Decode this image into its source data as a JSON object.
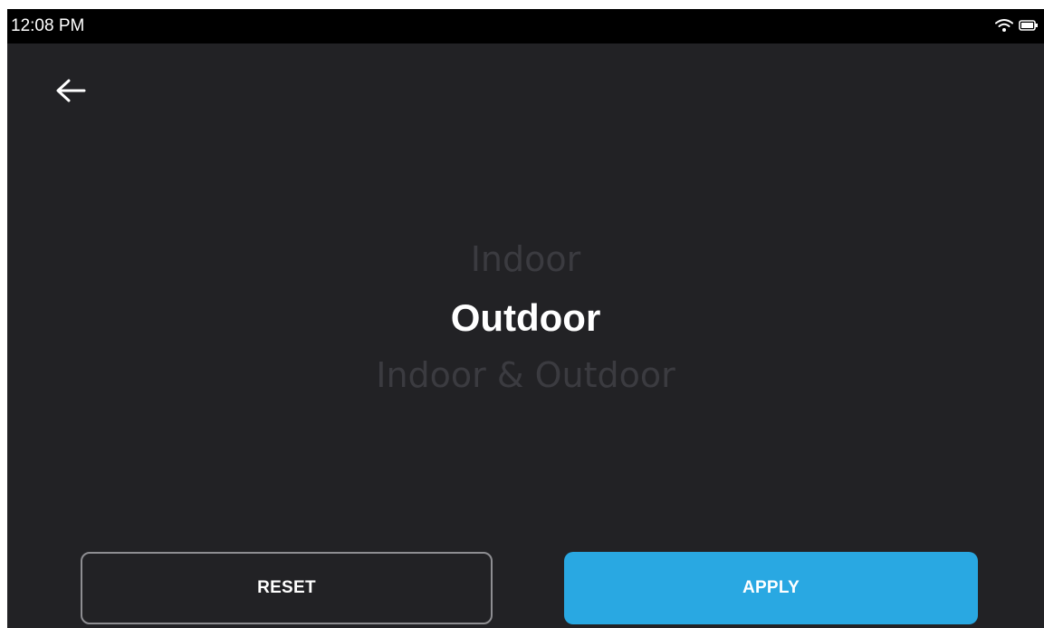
{
  "status_bar": {
    "time": "12:08 PM",
    "icons": [
      "wifi-icon",
      "battery-icon"
    ]
  },
  "nav": {
    "back_icon": "arrow-left-icon"
  },
  "picker": {
    "options": [
      "Indoor",
      "Outdoor",
      "Indoor & Outdoor"
    ],
    "selected": "Outdoor"
  },
  "actions": {
    "reset_label": "RESET",
    "apply_label": "APPLY"
  },
  "colors": {
    "background": "#222225",
    "status_bar": "#000000",
    "accent": "#29a8e2",
    "inactive_option": "#3b3b40",
    "active_option": "#ffffff"
  }
}
